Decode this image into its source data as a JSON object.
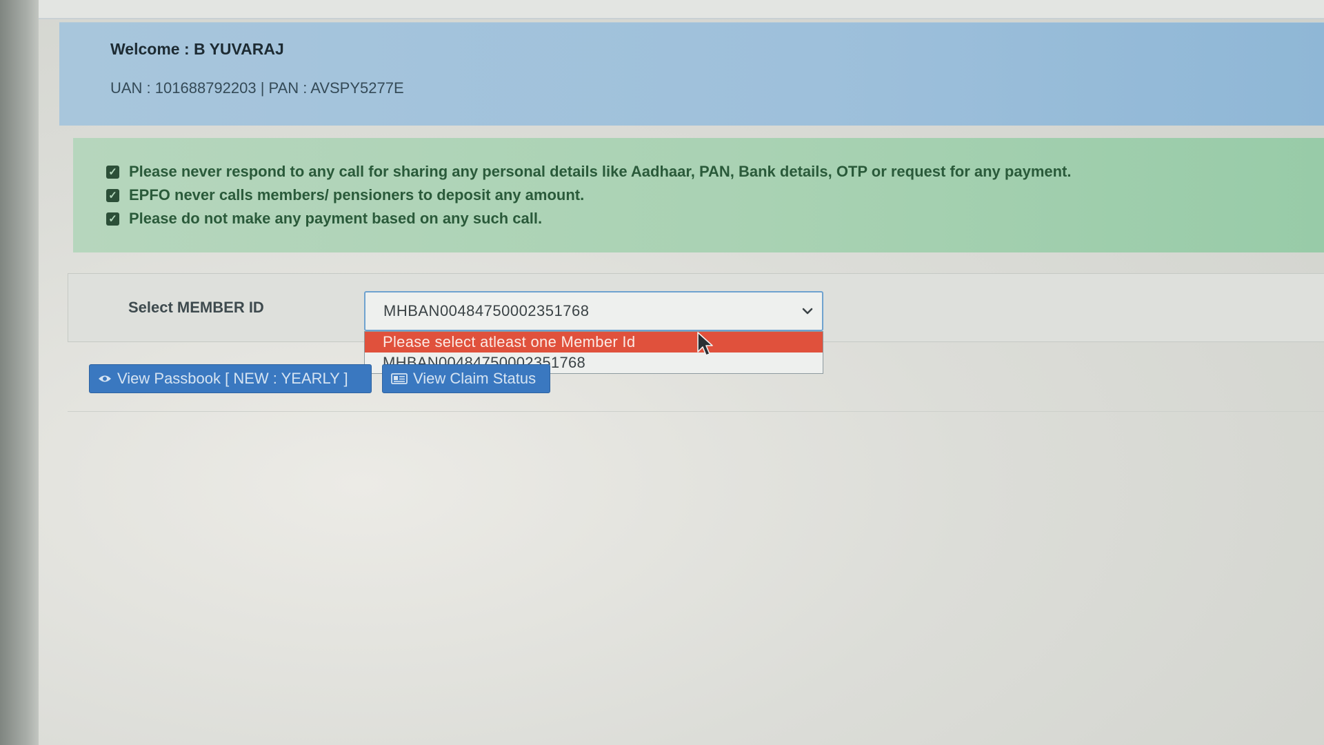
{
  "welcome": {
    "title": "Welcome : B YUVARAJ",
    "ids": "UAN : 101688792203 | PAN : AVSPY5277E"
  },
  "alerts": [
    "Please never respond to any call for sharing any personal details like Aadhaar, PAN, Bank details, OTP or request for any payment.",
    "EPFO never calls members/ pensioners to deposit any amount.",
    "Please do not make any payment based on any such call."
  ],
  "member": {
    "label": "Select MEMBER ID",
    "selected_value": "MHBAN00484750002351768",
    "options": [
      "Please select atleast one Member Id",
      "MHBAN00484750002351768"
    ]
  },
  "buttons": {
    "passbook": "View Passbook [ NEW : YEARLY ]",
    "claim_status": "View Claim Status"
  },
  "colors": {
    "welcome_bg": "#9ec0db",
    "alert_bg": "#a9d2b3",
    "highlight": "#e0513c",
    "button": "#3a78c0"
  }
}
